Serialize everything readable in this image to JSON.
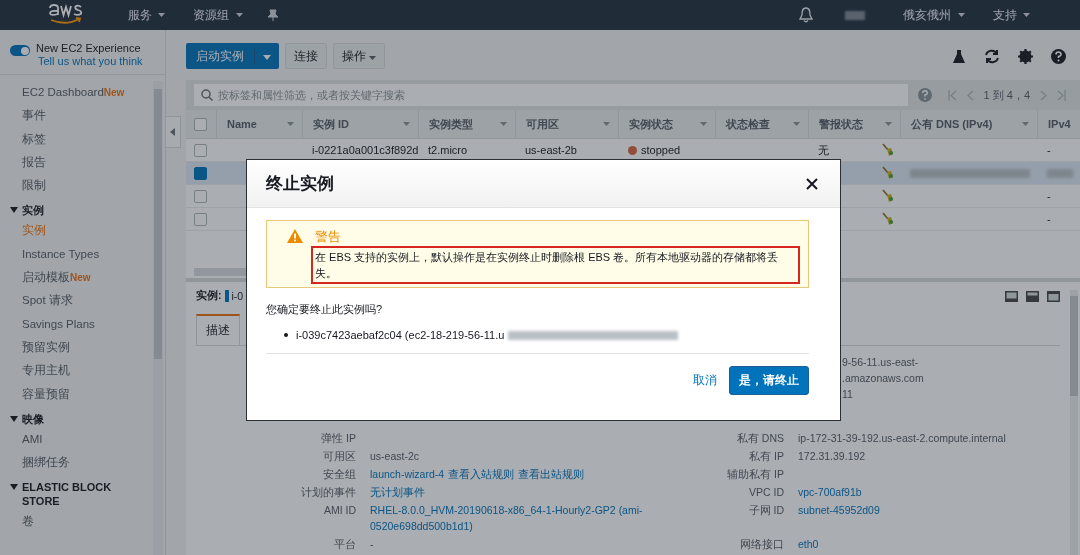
{
  "topbar": {
    "menus": [
      {
        "label": "服务"
      },
      {
        "label": "资源组"
      }
    ],
    "region": "俄亥俄州",
    "support": "支持"
  },
  "sidebar": {
    "experience": {
      "on": true,
      "title": "New EC2 Experience",
      "link": "Tell us what you think"
    },
    "items": [
      {
        "kind": "item",
        "label": "EC2 Dashboard",
        "badge": "New",
        "selected": false
      },
      {
        "kind": "item",
        "label": "事件",
        "selected": false
      },
      {
        "kind": "item",
        "label": "标签",
        "selected": false
      },
      {
        "kind": "item",
        "label": "报告",
        "selected": false
      },
      {
        "kind": "item",
        "label": "限制",
        "selected": false
      },
      {
        "kind": "section",
        "label": "实例",
        "expanded": true
      },
      {
        "kind": "item",
        "label": "实例",
        "selected": true
      },
      {
        "kind": "item",
        "label": "Instance Types",
        "selected": false
      },
      {
        "kind": "item",
        "label": "启动模板",
        "badge": "New",
        "selected": false
      },
      {
        "kind": "item",
        "label": "Spot 请求",
        "selected": false
      },
      {
        "kind": "item",
        "label": "Savings Plans",
        "selected": false
      },
      {
        "kind": "item",
        "label": "预留实例",
        "selected": false
      },
      {
        "kind": "item",
        "label": "专用主机",
        "selected": false
      },
      {
        "kind": "item",
        "label": "容量预留",
        "selected": false
      },
      {
        "kind": "section",
        "label": "映像",
        "expanded": true
      },
      {
        "kind": "item",
        "label": "AMI",
        "selected": false
      },
      {
        "kind": "item",
        "label": "捆绑任务",
        "selected": false
      },
      {
        "kind": "section",
        "label": "ELASTIC BLOCK STORE",
        "expanded": true
      },
      {
        "kind": "item",
        "label": "卷",
        "selected": false
      }
    ]
  },
  "toolbar": {
    "launch": "启动实例",
    "connect": "连接",
    "actions": "操作"
  },
  "search": {
    "placeholder": "按标签和属性筛选，或者按关键字搜索",
    "pagination": "1 到 4，4"
  },
  "table": {
    "columns": [
      "Name",
      "实例 ID",
      "实例类型",
      "可用区",
      "实例状态",
      "状态检查",
      "警报状态",
      "公有 DNS (IPv4)",
      "IPv4"
    ],
    "all_selected": false,
    "rows": [
      {
        "selected": false,
        "instance_id": "i-0221a0a001c3f892d",
        "type": "t2.micro",
        "zone": "us-east-2b",
        "state": "stopped",
        "color": "#934e3a",
        "alarm": "无",
        "ipv4": "-"
      },
      {
        "selected": true,
        "redacted": true
      },
      {
        "selected": false,
        "ipv4": "-"
      },
      {
        "selected": false,
        "ipv4": "-"
      }
    ]
  },
  "detail": {
    "instance_label": "实例:",
    "instance_id": "i-0",
    "tabs": [
      {
        "label": "描述",
        "selected": true
      }
    ],
    "fragments": [
      "9-56-11.us-east-",
      ".amazonaws.com",
      "11"
    ],
    "rows": [
      {
        "left": {
          "label": "弹性 IP"
        },
        "right": {
          "label": "私有 DNS",
          "values": [
            {
              "text": "ip-172-31-39-192.us-east-2.compute.internal",
              "kind": "text"
            }
          ]
        }
      },
      {
        "left": {
          "label": "可用区",
          "values": [
            {
              "text": "us-east-2c",
              "kind": "text"
            }
          ]
        },
        "right": {
          "label": "私有 IP",
          "values": [
            {
              "text": "172.31.39.192",
              "kind": "text"
            }
          ]
        }
      },
      {
        "left": {
          "label": "安全组",
          "values": [
            {
              "text": "launch-wizard-4",
              "kind": "link"
            },
            {
              "text": "查看入站规则",
              "kind": "link"
            },
            {
              "text": "查看出站规则",
              "kind": "link"
            }
          ]
        },
        "right": {
          "label": "辅助私有 IP"
        }
      },
      {
        "left": {
          "label": "计划的事件",
          "values": [
            {
              "text": "无计划事件",
              "kind": "link"
            }
          ]
        },
        "right": {
          "label": "VPC ID",
          "values": [
            {
              "text": "vpc-700af91b",
              "kind": "link"
            }
          ]
        }
      },
      {
        "left": {
          "label": "AMI ID",
          "values": [
            {
              "text": "RHEL-8.0.0_HVM-20190618-x86_64-1-Hourly2-GP2 (ami-0520e698dd500b1d1)",
              "kind": "link"
            }
          ]
        },
        "right": {
          "label": "子网 ID",
          "values": [
            {
              "text": "subnet-45952d09",
              "kind": "link"
            }
          ]
        }
      },
      {
        "left": {
          "label": "平台",
          "values": [
            {
              "text": "-",
              "kind": "text"
            }
          ]
        },
        "right": {
          "label": "网络接口",
          "values": [
            {
              "text": "eth0",
              "kind": "link"
            }
          ]
        }
      }
    ]
  },
  "modal": {
    "title": "终止实例",
    "warning": {
      "title": "警告",
      "text": "在 EBS 支持的实例上，默认操作是在实例终止时删除根 EBS 卷。所有本地驱动器的存储都将丢失。"
    },
    "question": "您确定要终止此实例吗?",
    "items": [
      {
        "text": "i-039c7423aebaf2c04 (ec2-18-219-56-11.u",
        "redacted": true
      }
    ],
    "cancel": "取消",
    "confirm": "是，请终止"
  }
}
